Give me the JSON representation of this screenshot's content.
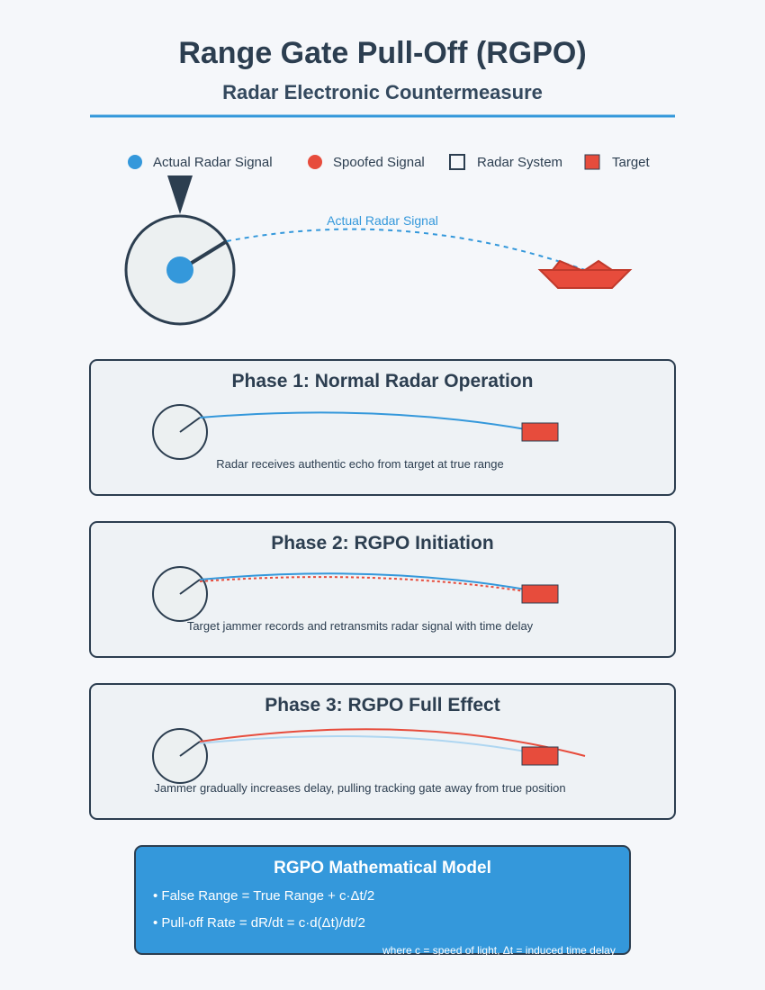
{
  "title": "Range Gate Pull-Off (RGPO)",
  "subtitle": "Radar Electronic Countermeasure",
  "legend": [
    {
      "label": "Actual Radar Signal",
      "shape": "circle",
      "color": "#3498db"
    },
    {
      "label": "Spoofed Signal",
      "shape": "circle",
      "color": "#e74c3c"
    },
    {
      "label": "Radar System",
      "shape": "square-outline",
      "color": "#2c3e50"
    },
    {
      "label": "Target",
      "shape": "square",
      "color": "#e74c3c"
    }
  ],
  "overview": {
    "signal_label": "Actual Radar Signal"
  },
  "phases": [
    {
      "title": "Phase 1: Normal Radar Operation",
      "caption": "Radar receives authentic echo from target at true range"
    },
    {
      "title": "Phase 2: RGPO Initiation",
      "caption": "Target jammer records and retransmits radar signal with time delay"
    },
    {
      "title": "Phase 3: RGPO Full Effect",
      "caption": "Jammer gradually increases delay, pulling tracking gate away from true position"
    }
  ],
  "model": {
    "title": "RGPO Mathematical Model",
    "lines": [
      "• False Range = True Range + c·Δt/2",
      "• Pull-off Rate = dR/dt = c·d(Δt)/dt/2"
    ],
    "note": "where c = speed of light, Δt = induced time delay"
  },
  "colors": {
    "accent": "#3498db",
    "spoof": "#e74c3c",
    "ink": "#2c3e50",
    "panel": "#eef2f5",
    "faded": "#aed6f1"
  }
}
